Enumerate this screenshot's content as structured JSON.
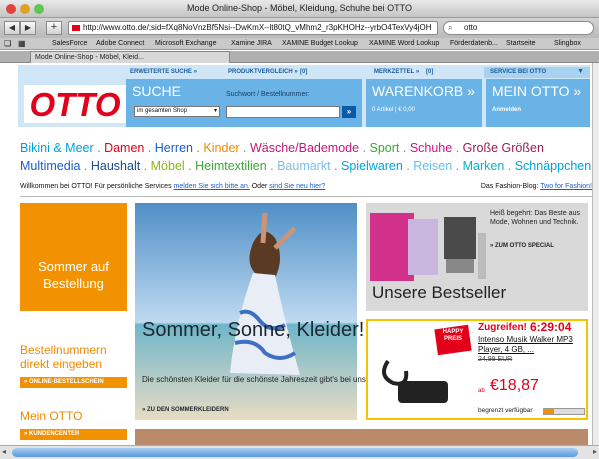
{
  "window": {
    "title": "Mode Online-Shop - Möbel, Kleidung, Schuhe bei OTTO"
  },
  "toolbar": {
    "back": "◀",
    "forward": "▶",
    "add": "+",
    "url": "http://www.otto.de/;sid=fXq8NoVnzBf5Nsi--DwKmX--lt80tQ_vMhm2_r3pKHOHz--yrbO4TexVy4jOH",
    "search": "otto"
  },
  "bookmarks": [
    "SalesForce",
    "Adobe Connect",
    "Microsoft Exchange",
    "Xamine JIRA",
    "XAMINE Budget Lookup",
    "XAMINE Word Lookup",
    "Förderdatenb...",
    "Startseite",
    "Slingbox"
  ],
  "tab": {
    "label": "Mode Online-Shop - Möbel, Kleid..."
  },
  "header": {
    "nav_erweitert": "ERWEITERTE SUCHE »",
    "nav_produkt": "PRODUKTVERGLEICH »",
    "nav_produkt_count": "[0]",
    "nav_merkzettel": "MERKZETTEL »",
    "nav_merkzettel_count": "[0]",
    "nav_service": "SERVICE BEI OTTO",
    "logo": "OTTO",
    "suche_title": "SUCHE",
    "suche_label": "Suchwort / Bestellnummer:",
    "suche_select": "im gesamten Shop",
    "warenkorb_title": "WARENKORB »",
    "warenkorb_info": "0 Artikel  |  € 0,00",
    "meinotto_title": "MEIN OTTO »",
    "meinotto_login": "Anmelden"
  },
  "categories": {
    "row1": [
      {
        "label": "Bikini & Meer",
        "color": "#00a3d9"
      },
      {
        "label": "Damen",
        "color": "#e2001a"
      },
      {
        "label": "Herren",
        "color": "#1a5ec8"
      },
      {
        "label": "Kinder",
        "color": "#f08a00"
      },
      {
        "label": "Wäsche/Bademode",
        "color": "#c2187a"
      },
      {
        "label": "Sport",
        "color": "#3aa935"
      },
      {
        "label": "Schuhe",
        "color": "#d40e8c"
      },
      {
        "label": "Große Größen",
        "color": "#9b1c5a"
      }
    ],
    "row2": [
      {
        "label": "Multimedia",
        "color": "#1a5ec8"
      },
      {
        "label": "Haushalt",
        "color": "#1a4a8c"
      },
      {
        "label": "Möbel",
        "color": "#8bb51a"
      },
      {
        "label": "Heimtextilien",
        "color": "#3aa935"
      },
      {
        "label": "Baumarkt",
        "color": "#7cbfe8"
      },
      {
        "label": "Spielwaren",
        "color": "#00a3d9"
      },
      {
        "label": "Reisen",
        "color": "#5fc4e8"
      },
      {
        "label": "Marken",
        "color": "#0fb1c8"
      },
      {
        "label": "Schnäppchen",
        "color": "#00a3d9"
      }
    ]
  },
  "welcome": {
    "prefix": "Willkommen bei OTTO! Für persönliche Services ",
    "link1": "melden Sie sich bitte an.",
    "mid": " Oder ",
    "link2": "sind Sie neu hier?",
    "right_prefix": "Das Fashion-Blog: ",
    "right_link": "Two for Fashion!"
  },
  "left": {
    "sommer": "Sommer auf Bestellung",
    "bestellnummern": "Bestellnummern direkt eingeben",
    "online_btn": "» ONLINE-BESTELLSCHEIN",
    "meinotto": "Mein OTTO",
    "kunden_btn": "» KUNDENCENTER"
  },
  "hero": {
    "title": "Sommer, Sonne, Kleider!",
    "sub": "Die schönsten Kleider für die schönste Jahreszeit gibt's bei uns.",
    "btn": "» ZU DEN SOMMERKLEIDERN"
  },
  "best": {
    "teaser": "Heiß begehrt: Das Beste aus Mode, Wohnen und Technik.",
    "link": "» ZUM OTTO SPECIAL",
    "title": "Unsere Bestseller"
  },
  "deal": {
    "badge": "HAPPY PREIS",
    "head": "Zugreifen!",
    "timer": "6:29:04",
    "name": "Intenso Musik Walker MP3 Player, 4 GB, ...",
    "old": "24,99 EUR",
    "ab": "ab",
    "price": "€18,87",
    "avail": "begrenzt verfügbar",
    "avail_fraction": 0.25
  },
  "colors": {
    "otto_red": "#e2001a",
    "orange": "#f39200",
    "header_blue": "#6ab3e6"
  }
}
